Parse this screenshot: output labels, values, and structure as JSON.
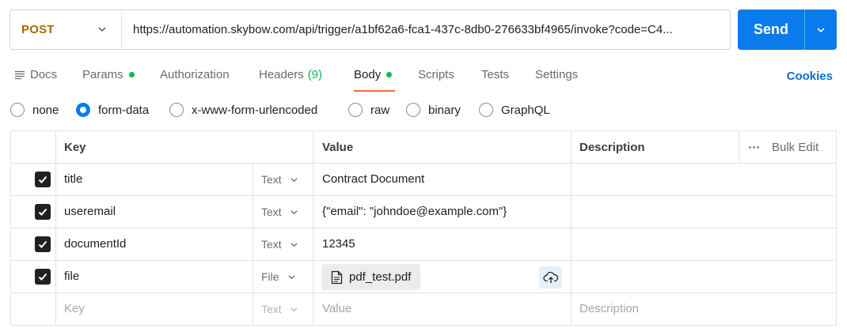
{
  "request": {
    "method": "POST",
    "url": "https://automation.skybow.com/api/trigger/a1bf62a6-fca1-437c-8db0-276633bf4965/invoke?code=C4...",
    "send_label": "Send"
  },
  "tabs": [
    {
      "label": "Docs"
    },
    {
      "label": "Params"
    },
    {
      "label": "Authorization"
    },
    {
      "label": "Headers",
      "count": "(9)"
    },
    {
      "label": "Body"
    },
    {
      "label": "Scripts"
    },
    {
      "label": "Tests"
    },
    {
      "label": "Settings"
    }
  ],
  "active_tab": "Body",
  "cookies_label": "Cookies",
  "body_types": [
    "none",
    "form-data",
    "x-www-form-urlencoded",
    "raw",
    "binary",
    "GraphQL"
  ],
  "selected_body_type": "form-data",
  "table": {
    "headers": {
      "key": "Key",
      "value": "Value",
      "description": "Description",
      "bulk_edit": "Bulk Edit"
    },
    "rows": [
      {
        "key": "title",
        "type": "Text",
        "value": "Contract Document",
        "checked": true
      },
      {
        "key": "useremail",
        "type": "Text",
        "value": "{\"email\": \"johndoe@example.com\"}",
        "checked": true
      },
      {
        "key": "documentId",
        "type": "Text",
        "value": "12345",
        "checked": true
      },
      {
        "key": "file",
        "type": "File",
        "value": "pdf_test.pdf",
        "checked": true
      }
    ],
    "placeholder_row": {
      "key": "Key",
      "type": "Text",
      "value": "Value",
      "description": "Description"
    }
  },
  "colors": {
    "accent": "#097bed",
    "method": "#a56a00",
    "indicator_dot": "#0cbb52",
    "tab_underline": "#ff6c37"
  },
  "icons": {
    "docs": "doc-lines-icon",
    "method_dropdown": "chevron-down-icon",
    "send_dropdown": "chevron-down-icon",
    "file": "file-icon",
    "upload": "cloud-upload-icon",
    "bulk_edit": "more-dots-icon"
  }
}
